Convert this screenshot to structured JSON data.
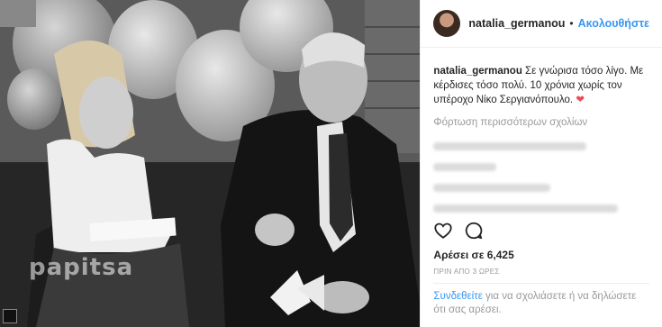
{
  "post": {
    "username": "natalia_germanou",
    "separator": "•",
    "follow_label": "Ακολουθήστε",
    "photo_watermark": "papitsa",
    "caption_user": "natalia_germanou",
    "caption_text": " Σε γνώρισα τόσο λίγο. Με κέρδισες τόσο πολύ. 10 χρόνια χωρίς τον υπέροχο Νίκο Σεργιανόπουλο. ",
    "caption_emoji": "❤",
    "load_more": "Φόρτωση περισσότερων σχολίων",
    "likes": "Αρέσει σε 6,425",
    "time": "ΠΡΙΝ ΑΠΟ 3 ΩΡΕΣ",
    "login_link": "Συνδεθείτε",
    "login_text": " για να σχολιάσετε ή να δηλώσετε ότι σας αρέσει."
  },
  "colors": {
    "link": "#3897f0",
    "heart": "#ed4956",
    "muted": "#999999"
  },
  "icons": [
    "heart-outline-icon",
    "comment-bubble-icon",
    "corner-badge-icon"
  ]
}
